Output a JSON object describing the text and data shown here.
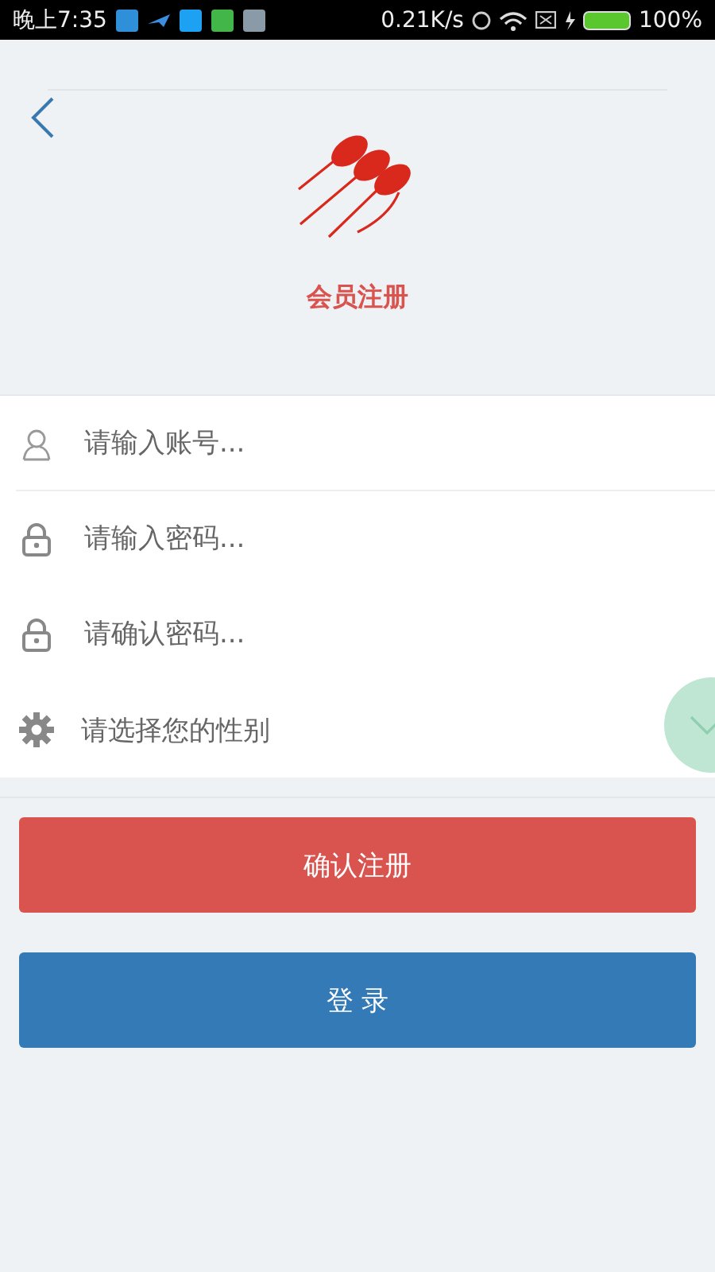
{
  "status_bar": {
    "time": "晚上7:35",
    "speed": "0.21K/s",
    "battery": "100%"
  },
  "header": {
    "title": "会员注册"
  },
  "fields": [
    {
      "kind": "account",
      "placeholder": "请输入账号..."
    },
    {
      "kind": "password",
      "placeholder": "请输入密码..."
    },
    {
      "kind": "password",
      "placeholder": "请确认密码..."
    },
    {
      "kind": "gender",
      "placeholder": "请选择您的性别"
    }
  ],
  "buttons": [
    {
      "kind": "primary",
      "label": "确认注册"
    },
    {
      "kind": "secondary",
      "label": "登 录"
    }
  ]
}
